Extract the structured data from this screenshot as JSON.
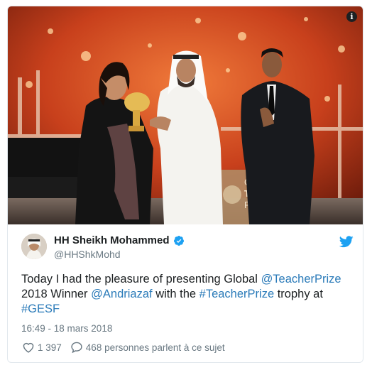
{
  "tweet": {
    "author_name": "HH Sheikh Mohammed",
    "handle": "@HHShkMohd",
    "text_parts": [
      {
        "t": "Today I had the pleasure of presenting Global ",
        "link": false
      },
      {
        "t": "@TeacherPrize",
        "link": true
      },
      {
        "t": " 2018 Winner ",
        "link": false
      },
      {
        "t": "@Andriazaf",
        "link": true
      },
      {
        "t": " with the ",
        "link": false
      },
      {
        "t": "#TeacherPrize",
        "link": true
      },
      {
        "t": " trophy at ",
        "link": false
      },
      {
        "t": "#GESF",
        "link": true
      }
    ],
    "timestamp": "16:49 - 18 mars 2018",
    "likes": "1 397",
    "replies_text": "468 personnes parlent à ce sujet"
  },
  "photo": {
    "sign_text": [
      "GL",
      "TE",
      "PRI"
    ]
  },
  "colors": {
    "link": "#2b7bb9",
    "twitter_blue": "#1da1f2",
    "muted": "#697882",
    "background_stage": "#c43a1a"
  },
  "icons": {
    "info": "info-icon",
    "verified": "verified-badge-icon",
    "twitter": "twitter-bird-icon",
    "like": "heart-icon",
    "reply": "speech-bubble-icon"
  }
}
